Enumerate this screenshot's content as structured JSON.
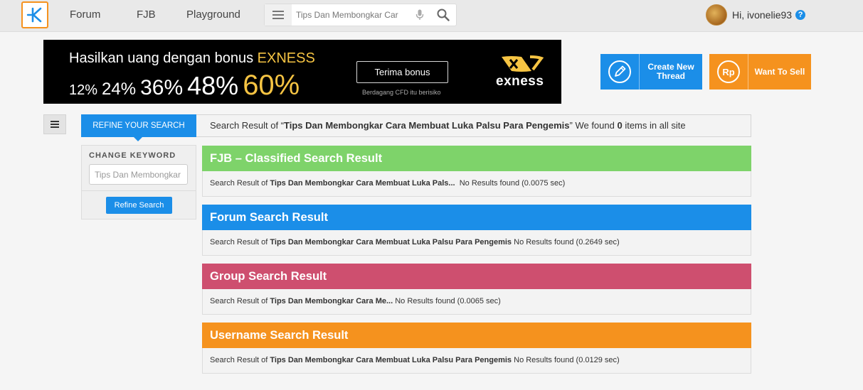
{
  "nav": {
    "links": [
      "Forum",
      "FJB",
      "Playground"
    ],
    "search_value": "Tips Dan Membongkar Car",
    "user_greeting": "Hi, ivonelie93",
    "help": "?"
  },
  "banner": {
    "headline_prefix": "Hasilkan uang dengan bonus",
    "headline_brand": "EXNESS",
    "percents": [
      "12%",
      "24%",
      "36%",
      "48%",
      "60%"
    ],
    "button": "Terima bonus",
    "disclaimer": "Berdagang CFD itu berisiko",
    "logo_text": "exness"
  },
  "actions": {
    "create_line1": "Create New",
    "create_line2": "Thread",
    "sell": "Want To Sell",
    "sell_icon_text": "Rp"
  },
  "refine": {
    "tab": "REFINE YOUR SEARCH",
    "summary_prefix": "Search Result of “",
    "summary_query": "Tips Dan Membongkar Cara Membuat Luka Palsu Para Pengemis",
    "summary_mid": "” We found ",
    "summary_count": "0",
    "summary_suffix": " items in all site"
  },
  "keyword_panel": {
    "title": "CHANGE KEYWORD",
    "input_value": "Tips Dan Membongkar",
    "button": "Refine Search"
  },
  "sections": [
    {
      "title": "FJB – Classified Search Result",
      "color": "#7ed36a",
      "prefix": "Search Result of ",
      "query": "Tips Dan Membongkar Cara Membuat Luka Pals...",
      "result": "No Results found (0.0075 sec)"
    },
    {
      "title": "Forum Search Result",
      "color": "#1b8ee8",
      "prefix": "Search Result of ",
      "query": "Tips Dan Membongkar Cara Membuat Luka Palsu Para Pengemis",
      "result": "No Results found (0.2649 sec)"
    },
    {
      "title": "Group Search Result",
      "color": "#ce4f6f",
      "prefix": "Search Result of ",
      "query": "Tips Dan Membongkar Cara Me...",
      "result": "No Results found (0.0065 sec)"
    },
    {
      "title": "Username Search Result",
      "color": "#f5921e",
      "prefix": "Search Result of ",
      "query": "Tips Dan Membongkar Cara Membuat Luka Palsu Para Pengemis",
      "result": "No Results found (0.0129 sec)"
    }
  ],
  "colors": {
    "accent_blue": "#1b8ee8",
    "accent_orange": "#f5921e",
    "banner_gold": "#f6c443"
  }
}
